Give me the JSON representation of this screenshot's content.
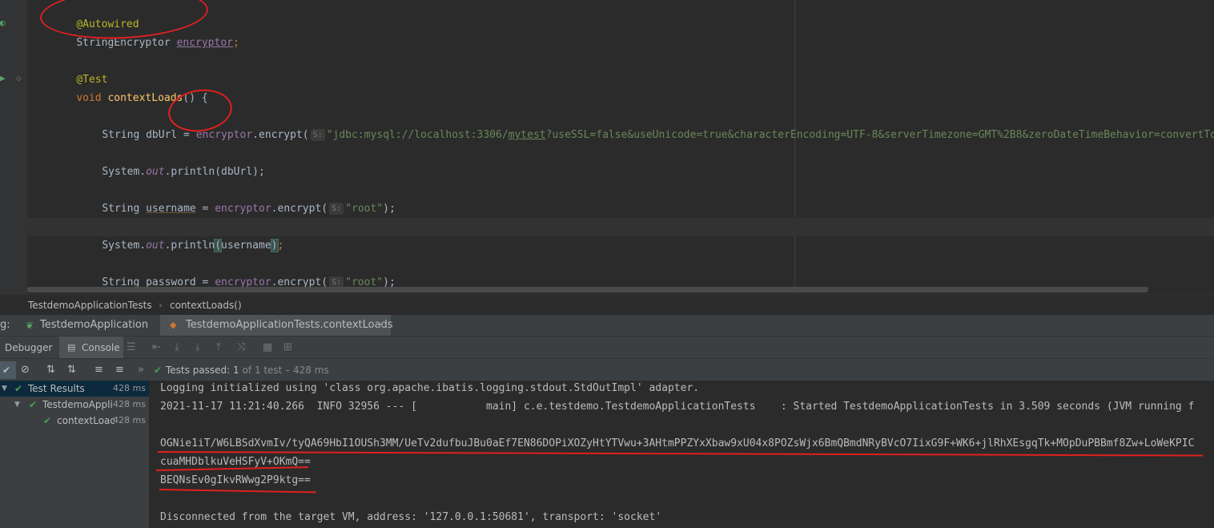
{
  "editor": {
    "lines": {
      "l1": "@Autowired",
      "l2_type": "StringEncryptor",
      "l2_var": "encryptor",
      "l2_semi": ";",
      "l3": "@Test",
      "l4_void": "void",
      "l4_name": "contextLoads",
      "l4_rest": "() {",
      "l5_a": "String dbUrl = ",
      "l5_b": "encryptor",
      "l5_c": ".encrypt(",
      "l5_hint": "S:",
      "l5_str1": "\"jdbc:mysql://localhost:3306/",
      "l5_str2": "mytest",
      "l5_str3": "?useSSL=false&useUnicode=true&characterEncoding=UTF-8&serverTimezone=GMT%2B8&zeroDateTimeBehavior=convertTo",
      "l6_a": "System.",
      "l6_out": "out",
      "l6_b": ".println(dbUrl);",
      "l7_a": "String ",
      "l7_var": "username",
      "l7_b": " = ",
      "l7_enc": "encryptor",
      "l7_c": ".encrypt(",
      "l7_hint": "S:",
      "l7_str": "\"root\"",
      "l7_d": ");",
      "l8_a": "System.",
      "l8_out": "out",
      "l8_b": ".println",
      "l8_p1": "(",
      "l8_var": "username",
      "l8_p2": ")",
      "l8_semi": ";",
      "l9_a": "String password = ",
      "l9_enc": "encryptor",
      "l9_c": ".encrypt(",
      "l9_hint": "S:",
      "l9_str": "\"root\"",
      "l9_d": ");"
    }
  },
  "breadcrumb": {
    "class": "TestdemoApplicationTests",
    "sep": "›",
    "method": "contextLoads()"
  },
  "runbar": {
    "prefix": "g:",
    "tab1": "TestdemoApplication",
    "tab2": "TestdemoApplicationTests.contextLoads",
    "close": "×"
  },
  "dbgbar": {
    "debugger": "Debugger",
    "console": "Console"
  },
  "testbar": {
    "status_prefix": "Tests passed:",
    "passed": "1",
    "of": "of 1 test",
    "duration": "– 428 ms"
  },
  "tree": {
    "rows": [
      {
        "label": "Test Results",
        "time": "428 ms"
      },
      {
        "label": "TestdemoAppli",
        "time": "428 ms"
      },
      {
        "label": "contextLoad",
        "time": "428 ms"
      }
    ]
  },
  "console": {
    "lines": [
      "Logging initialized using 'class org.apache.ibatis.logging.stdout.StdOutImpl' adapter.",
      "2021-11-17 11:21:40.266  INFO 32956 --- [           main] c.e.testdemo.TestdemoApplicationTests    : Started TestdemoApplicationTests in 3.509 seconds (JVM running f",
      "",
      "OGNie1iT/W6LBSdXvmIv/tyQA69HbI1OUSh3MM/UeTv2dufbuJBu0aEf7EN86DOPiXOZyHtYTVwu+3AHtmPPZYxXbaw9xU04x8POZsWjx6BmQBmdNRyBVcO7IixG9F+WK6+jlRhXEsgqTk+MOpDuPBBmf8Zw+LoWeKPIC",
      "cuaMHDblkuVeHSFyV+OKmQ==",
      "BEQNsEv0gIkvRWwg2P9ktg==",
      "",
      "Disconnected from the target VM, address: '127.0.0.1:50681', transport: 'socket'"
    ]
  },
  "colors": {
    "annotation": "#bbb529",
    "keyword": "#cc7832",
    "field": "#9876aa",
    "string": "#6a8759",
    "marker": "#e02020",
    "pass": "#499c54"
  }
}
